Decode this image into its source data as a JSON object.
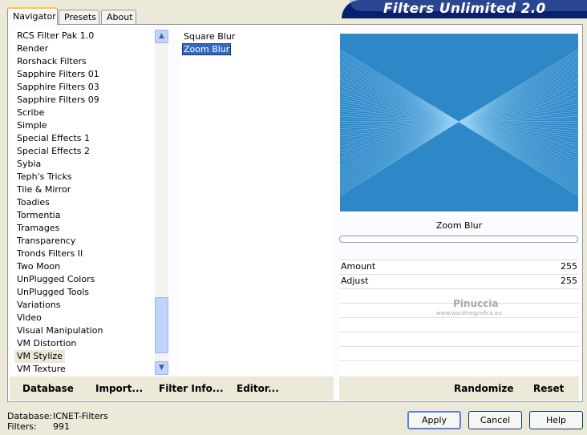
{
  "app_title": "Filters Unlimited 2.0",
  "tabs": [
    {
      "label": "Navigator",
      "active": true
    },
    {
      "label": "Presets",
      "active": false
    },
    {
      "label": "About",
      "active": false
    }
  ],
  "categories": [
    "RCS Filter Pak 1.0",
    "Render",
    "Rorshack Filters",
    "Sapphire Filters 01",
    "Sapphire Filters 03",
    "Sapphire Filters 09",
    "Scribe",
    "Simple",
    "Special Effects 1",
    "Special Effects 2",
    "Sybia",
    "Teph's Tricks",
    "Tile & Mirror",
    "Toadies",
    "Tormentia",
    "Tramages",
    "Transparency",
    "Tronds Filters II",
    "Two Moon",
    "UnPlugged Colors",
    "UnPlugged Tools",
    "Variations",
    "Video",
    "Visual Manipulation",
    "VM Distortion",
    "VM Stylize",
    "VM Texture"
  ],
  "selected_category": "VM Stylize",
  "filters": [
    "Square Blur",
    "Zoom Blur"
  ],
  "selected_filter": "Zoom Blur",
  "preview": {
    "filter_name": "Zoom Blur",
    "colors": {
      "background": "#2e88c8",
      "light": "#9cd4f4"
    }
  },
  "parameters": [
    {
      "label": "Amount",
      "value": "255"
    },
    {
      "label": "Adjust",
      "value": "255"
    }
  ],
  "watermark": {
    "name": "Pinuccia",
    "site": "www.wardinegrafica.eu"
  },
  "actions_left": {
    "database": "Database",
    "import": "Import...",
    "filter_info": "Filter Info...",
    "editor": "Editor..."
  },
  "actions_right": {
    "randomize": "Randomize",
    "reset": "Reset"
  },
  "status": {
    "database_label": "Database:",
    "database_value": "ICNET-Filters",
    "filters_label": "Filters:",
    "filters_value": "991"
  },
  "dialog_buttons": {
    "apply": "Apply",
    "cancel": "Cancel",
    "help": "Help"
  }
}
